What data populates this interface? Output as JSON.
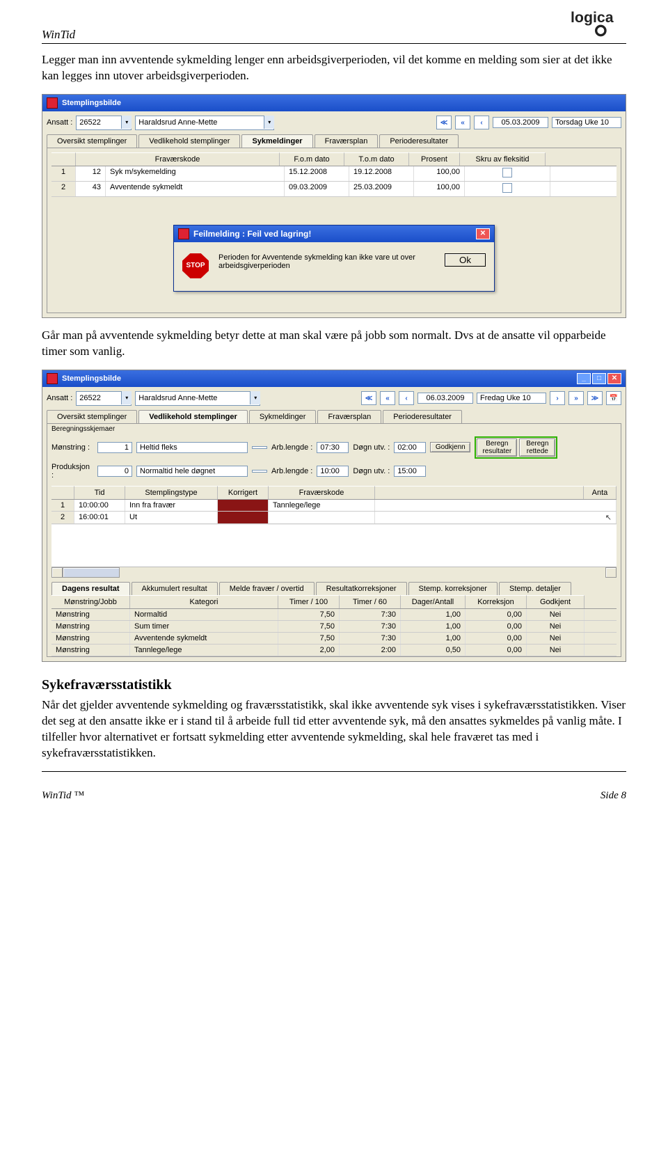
{
  "header": {
    "doc_title": "WinTid"
  },
  "para1": "Legger man inn avventende sykmelding lenger enn arbeidsgiverperioden, vil det komme en melding som sier at det ikke kan legges inn utover arbeidsgiverperioden.",
  "para2": "Går man på avventende sykmelding betyr dette at man skal være på jobb som normalt. Dvs at de ansatte vil opparbeide timer som vanlig.",
  "section_heading": "Sykefraværsstatistikk",
  "para3": "Når det gjelder avventende sykmelding og fraværsstatistikk, skal ikke avventende syk vises i sykefraværsstatistikken. Viser det seg at den ansatte ikke er i stand til å arbeide full tid etter avventende syk, må den ansattes sykmeldes på vanlig måte. I tilfeller hvor alternativet er fortsatt sykmelding etter avventende sykmelding, skal hele fraværet tas med i sykefraværsstatistikken.",
  "footer": {
    "left": "WinTid ™",
    "right": "Side 8"
  },
  "shot1": {
    "title": "Stemplingsbilde",
    "ansatt_lbl": "Ansatt :",
    "ansatt_id": "26522",
    "ansatt_name": "Haraldsrud Anne-Mette",
    "date": "05.03.2009",
    "day": "Torsdag Uke 10",
    "tabs": {
      "t1": "Oversikt stemplinger",
      "t2": "Vedlikehold stemplinger",
      "t3": "Sykmeldinger",
      "t4": "Fraværsplan",
      "t5": "Perioderesultater"
    },
    "cols": {
      "c1": "Fraværskode",
      "c2": "F.o.m dato",
      "c3": "T.o.m dato",
      "c4": "Prosent",
      "c5": "Skru av fleksitid"
    },
    "rows": [
      {
        "n": "1",
        "code": "12",
        "name": "Syk m/sykemelding",
        "from": "15.12.2008",
        "to": "19.12.2008",
        "pct": "100,00"
      },
      {
        "n": "2",
        "code": "43",
        "name": "Avventende sykmeldt",
        "from": "09.03.2009",
        "to": "25.03.2009",
        "pct": "100,00"
      }
    ],
    "dlg_title": "Feilmelding : Feil ved lagring!",
    "dlg_msg": "Perioden for Avventende sykmelding kan ikke vare ut over arbeidsgiverperioden",
    "dlg_stop": "STOP",
    "dlg_ok": "Ok"
  },
  "shot2": {
    "title": "Stemplingsbilde",
    "ansatt_lbl": "Ansatt :",
    "ansatt_id": "26522",
    "ansatt_name": "Haraldsrud Anne-Mette",
    "date": "06.03.2009",
    "day": "Fredag  Uke 10",
    "tabs": {
      "t1": "Oversikt stemplinger",
      "t2": "Vedlikehold stemplinger",
      "t3": "Sykmeldinger",
      "t4": "Fraværsplan",
      "t5": "Perioderesultater"
    },
    "group_lbl": "Beregningsskjemaer",
    "monstring_lbl": "Mønstring :",
    "monstring_val": "1",
    "monstring_name": "Heltid fleks",
    "prod_lbl": "Produksjon :",
    "prod_val": "0",
    "prod_name": "Normaltid hele døgnet",
    "arblen_lbl": "Arb.lengde :",
    "arblen1": "07:30",
    "arblen2": "10:00",
    "dogn_lbl": "Døgn utv. :",
    "dogn1": "02:00",
    "dogn2": "15:00",
    "godkjenn": "Godkjenn",
    "beregn_res": "Beregn resultater",
    "beregn_ret": "Beregn rettede",
    "gcols": {
      "c1": "Tid",
      "c2": "Stemplingstype",
      "c3": "Korrigert",
      "c4": "Fraværskode",
      "c5": "Anta"
    },
    "grows": [
      {
        "n": "1",
        "tid": "10:00:00",
        "type": "Inn fra fravær",
        "frav": "Tannlege/lege"
      },
      {
        "n": "2",
        "tid": "16:00:01",
        "type": "Ut",
        "frav": ""
      }
    ],
    "tabs2": {
      "t1": "Dagens resultat",
      "t2": "Akkumulert resultat",
      "t3": "Melde fravær / overtid",
      "t4": "Resultatkorreksjoner",
      "t5": "Stemp. korreksjoner",
      "t6": "Stemp. detaljer"
    },
    "rcols": {
      "c1": "Mønstring/Jobb",
      "c2": "Kategori",
      "c3": "Timer / 100",
      "c4": "Timer / 60",
      "c5": "Dager/Antall",
      "c6": "Korreksjon",
      "c7": "Godkjent"
    },
    "rrows": [
      {
        "a": "Mønstring",
        "b": "Normaltid",
        "c": "7,50",
        "d": "7:30",
        "e": "1,00",
        "f": "0,00",
        "g": "Nei"
      },
      {
        "a": "Mønstring",
        "b": "Sum timer",
        "c": "7,50",
        "d": "7:30",
        "e": "1,00",
        "f": "0,00",
        "g": "Nei"
      },
      {
        "a": "Mønstring",
        "b": "Avventende sykmeldt",
        "c": "7,50",
        "d": "7:30",
        "e": "1,00",
        "f": "0,00",
        "g": "Nei"
      },
      {
        "a": "Mønstring",
        "b": "Tannlege/lege",
        "c": "2,00",
        "d": "2:00",
        "e": "0,50",
        "f": "0,00",
        "g": "Nei"
      }
    ]
  }
}
